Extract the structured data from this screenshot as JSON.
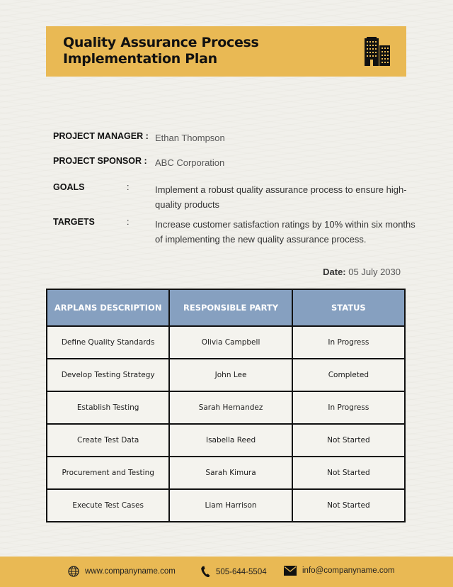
{
  "header": {
    "title_line1": "Quality Assurance Process",
    "title_line2": "Implementation Plan",
    "icon": "building-icon"
  },
  "info": {
    "project_manager": {
      "label": "PROJECT MANAGER :",
      "value": "Ethan Thompson"
    },
    "project_sponsor": {
      "label": "PROJECT SPONSOR :",
      "value": "ABC Corporation"
    },
    "goals": {
      "label": "GOALS",
      "colon": ":",
      "value": "Implement a robust quality assurance process to ensure high-quality products"
    },
    "targets": {
      "label": "TARGETS",
      "colon": ":",
      "value": "Increase customer satisfaction ratings by 10% within six months of implementing the new quality assurance process."
    }
  },
  "date": {
    "label": "Date:",
    "value": "05 July 2030"
  },
  "table": {
    "headers": [
      "ARPLANS DESCRIPTION",
      "RESPONSIBLE PARTY",
      "STATUS"
    ],
    "rows": [
      [
        "Define Quality Standards",
        "Olivia Campbell",
        "In Progress"
      ],
      [
        "Develop Testing Strategy",
        "John Lee",
        "Completed"
      ],
      [
        "Establish Testing",
        "Sarah Hernandez",
        "In Progress"
      ],
      [
        "Create Test Data",
        "Isabella Reed",
        "Not Started"
      ],
      [
        "Procurement and Testing",
        "Sarah Kimura",
        "Not Started"
      ],
      [
        "Execute Test Cases",
        "Liam Harrison",
        "Not Started"
      ]
    ]
  },
  "footer": {
    "website": "www.companyname.com",
    "phone": "505-644-5504",
    "email": "info@companyname.com"
  },
  "colors": {
    "accent_yellow": "#e9b954",
    "table_header_blue": "#86a0c0",
    "background": "#f1f0eb"
  }
}
